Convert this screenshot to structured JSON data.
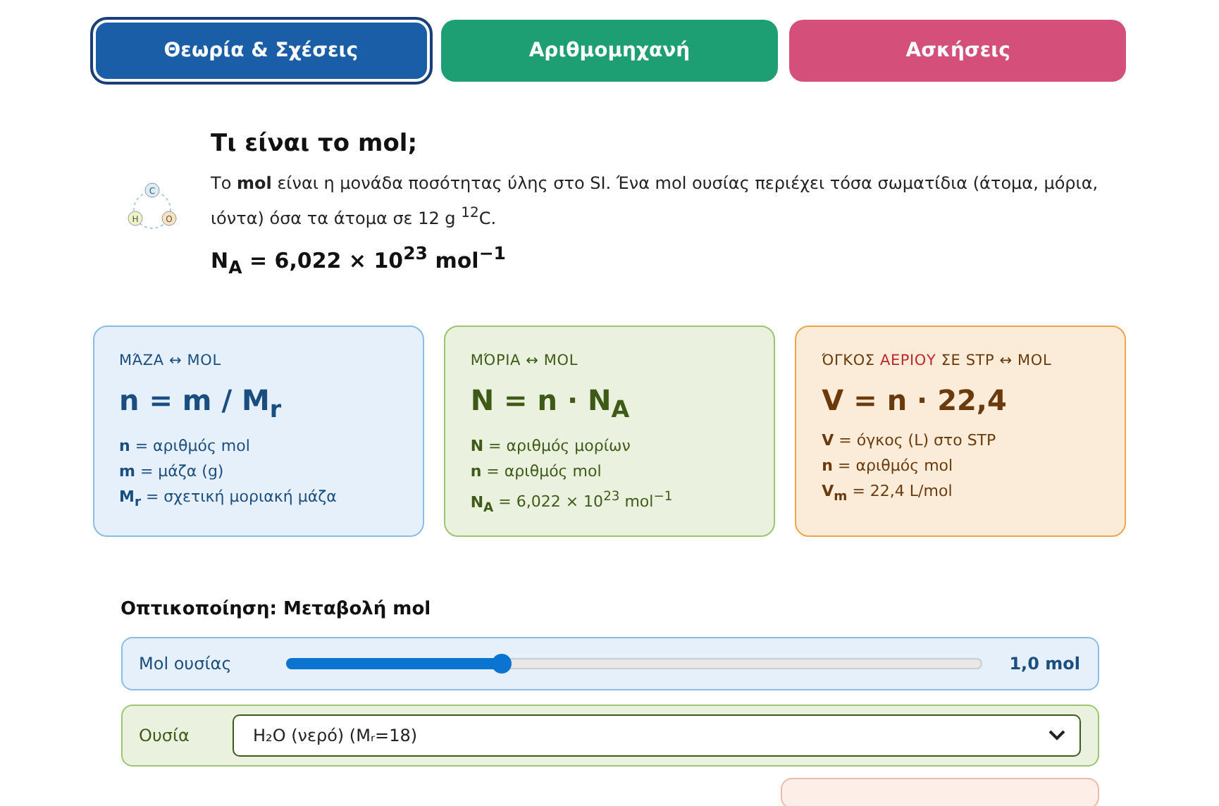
{
  "tabs": [
    {
      "label": "Θεωρία & Σχέσεις",
      "selected": true,
      "color": "#1a5ea8"
    },
    {
      "label": "Αριθμομηχανή",
      "selected": false,
      "color": "#1e9e73"
    },
    {
      "label": "Ασκήσεις",
      "selected": false,
      "color": "#d4507a"
    }
  ],
  "intro": {
    "atoms": [
      "C",
      "H",
      "O"
    ],
    "title": "Τι είναι το mol;",
    "text": "Το **mol** είναι η μονάδα ποσότητας ύλης στο SI. Ένα mol ουσίας περιέχει τόσα σωματίδια (άτομα, μόρια, ιόντα) όσα τα άτομα σε 12 g $^{12}$C.",
    "constant": "N$_{A}$ = 6,022 × 10$^{23}$ mol$^{−1}$"
  },
  "cards": [
    {
      "kind": "blue",
      "heading": "ΜΆΖΑ ↔ MOL",
      "formula": "n = m / M$_{r}$",
      "legend": [
        "**n** = αριθμός mol",
        "**m** = μάζα (g)",
        "**M$_{r}$** = σχετική μοριακή μάζα"
      ]
    },
    {
      "kind": "green",
      "heading": "ΜΌΡΙΑ ↔ MOL",
      "formula": "N = n · N$_{A}$",
      "legend": [
        "**N** = αριθμός μορίων",
        "**n** = αριθμός mol",
        "**N$_{A}$** = 6,022 × 10$^{23}$ mol$^{−1}$"
      ]
    },
    {
      "kind": "orange",
      "heading": "ΌΓΚΟΣ **ΑΕΡΙΟΥ** ΣΕ STP ↔ MOL",
      "formula": "V = n · 22,4",
      "legend": [
        "**V** = όγκος (L) στο STP",
        "**n** = αριθμός mol",
        "**V$_{m}$** = 22,4 L/mol"
      ]
    }
  ],
  "visualization": {
    "title": "Οπτικοποίηση: Μεταβολή mol",
    "slider": {
      "label": "Mol ουσίας",
      "level": 0.31,
      "reading": "1,0 mol"
    },
    "substance": {
      "label": "Ουσία",
      "value": "H₂O (νερό) (Mᵣ=18)"
    }
  }
}
